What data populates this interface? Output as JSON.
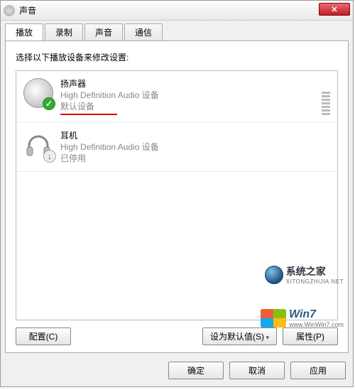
{
  "window": {
    "title": "声音"
  },
  "tabs": {
    "playback": "播放",
    "recording": "录制",
    "sounds": "声音",
    "comm": "通信"
  },
  "instruction": "选择以下播放设备来修改设置:",
  "devices": [
    {
      "name": "扬声器",
      "desc": "High Definition Audio 设备",
      "status": "默认设备",
      "icon": "speaker",
      "badge": "check"
    },
    {
      "name": "耳机",
      "desc": "High Definition Audio 设备",
      "status": "已停用",
      "icon": "headphone",
      "badge": "down"
    }
  ],
  "panel_buttons": {
    "configure": "配置(C)",
    "set_default": "设为默认值(S)",
    "properties": "属性(P)"
  },
  "dialog_buttons": {
    "ok": "确定",
    "cancel": "取消",
    "apply": "应用"
  },
  "watermark": {
    "top_text": "系统之家",
    "top_sub": "XITONGZHIJIA.NET",
    "bottom_text": "Win7",
    "bottom_sub": "www.WinWin7.com"
  }
}
